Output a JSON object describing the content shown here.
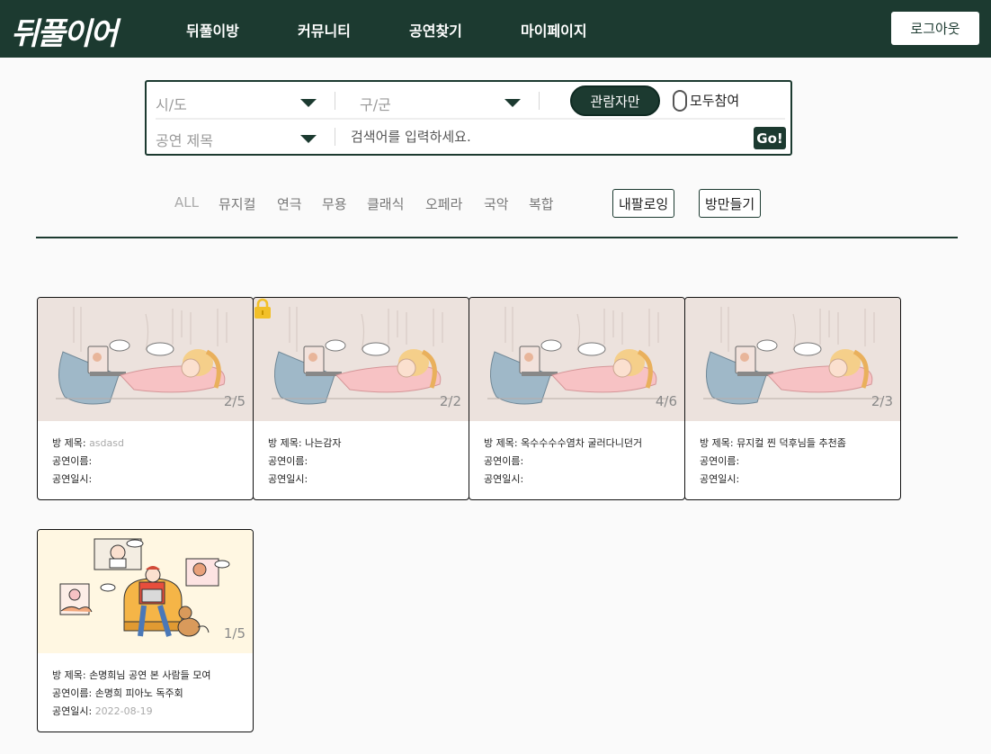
{
  "header": {
    "logo": "뒤풀이어",
    "nav": [
      "뒤풀이방",
      "커뮤니티",
      "공연찾기",
      "마이페이지"
    ],
    "logout": "로그아웃"
  },
  "search": {
    "sido": "시/도",
    "gugun": "구/군",
    "title_select": "공연 제목",
    "placeholder": "검색어를 입력하세요.",
    "go": "Go!",
    "toggle_on": "관람자만",
    "toggle_off": "모두참여"
  },
  "categories": [
    "ALL",
    "뮤지컬",
    "연극",
    "무용",
    "클래식",
    "오페라",
    "국악",
    "복합"
  ],
  "actions": {
    "my_rooms": "내팔로잉",
    "create_room": "방만들기"
  },
  "labels": {
    "room_title": "방 제목: ",
    "show_name": "공연이름: ",
    "show_date": "공연일시: "
  },
  "colors": {
    "primary": "#1c3a30",
    "lock": "#f2c029"
  },
  "rooms": [
    {
      "count": "2/5",
      "title": "asdasd",
      "show": "",
      "date": "",
      "locked": false,
      "image": "video-call-illustration"
    },
    {
      "count": "2/2",
      "title": "나는감자",
      "show": "",
      "date": "",
      "locked": true,
      "image": "video-call-illustration"
    },
    {
      "count": "4/6",
      "title": "옥수수수수염차 굴러다니던거",
      "show": "",
      "date": "",
      "locked": false,
      "image": "video-call-illustration"
    },
    {
      "count": "2/3",
      "title": "뮤지컬 찐 덕후님들 추천좀",
      "show": "",
      "date": "",
      "locked": false,
      "image": "video-call-illustration"
    },
    {
      "count": "1/5",
      "title": "손명희님 공연 본 사람들 모여",
      "show": "손명희 피아노 독주회",
      "date": "2022-08-19",
      "locked": false,
      "image": "group-chat-illustration"
    }
  ]
}
